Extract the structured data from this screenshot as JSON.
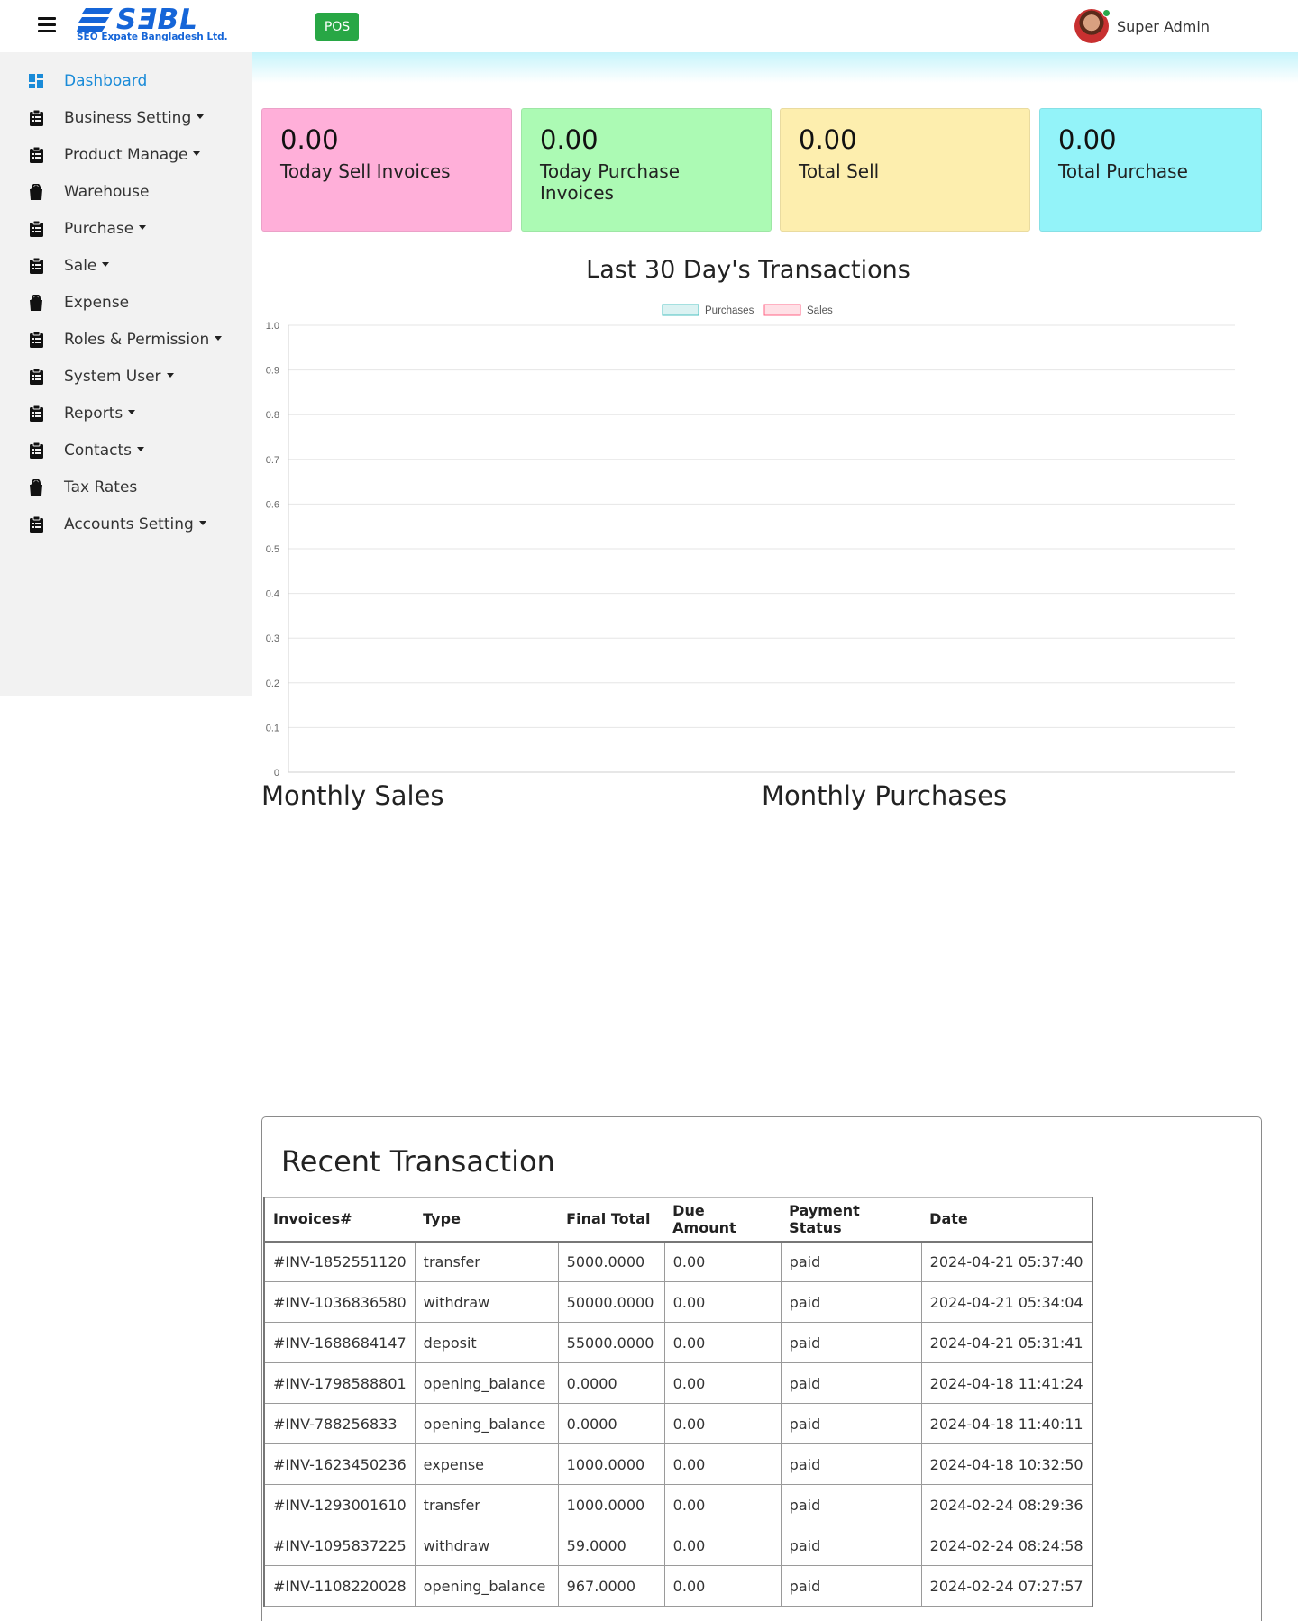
{
  "header": {
    "logo_text": "SƎBL",
    "logo_subtitle": "SEO Expate Bangladesh Ltd.",
    "pos_label": "POS",
    "user_name": "Super Admin"
  },
  "sidebar": {
    "items": [
      {
        "label": "Dashboard",
        "icon": "dashboard-icon",
        "dropdown": false,
        "active": true
      },
      {
        "label": "Business Setting",
        "icon": "clipboard-icon",
        "dropdown": true
      },
      {
        "label": "Product Manage",
        "icon": "clipboard-icon",
        "dropdown": true
      },
      {
        "label": "Warehouse",
        "icon": "bag-icon",
        "dropdown": false
      },
      {
        "label": "Purchase",
        "icon": "clipboard-icon",
        "dropdown": true
      },
      {
        "label": "Sale",
        "icon": "clipboard-icon",
        "dropdown": true
      },
      {
        "label": "Expense",
        "icon": "bag-icon",
        "dropdown": false
      },
      {
        "label": "Roles & Permission",
        "icon": "clipboard-icon",
        "dropdown": true
      },
      {
        "label": "System User",
        "icon": "clipboard-icon",
        "dropdown": true
      },
      {
        "label": "Reports",
        "icon": "clipboard-icon",
        "dropdown": true
      },
      {
        "label": "Contacts",
        "icon": "clipboard-icon",
        "dropdown": true
      },
      {
        "label": "Tax Rates",
        "icon": "bag-icon",
        "dropdown": false
      },
      {
        "label": "Accounts Setting",
        "icon": "clipboard-icon",
        "dropdown": true
      }
    ]
  },
  "cards": [
    {
      "value": "0.00",
      "label": "Today Sell Invoices",
      "color": "#ffafd9"
    },
    {
      "value": "0.00",
      "label": "Today Purchase Invoices",
      "color": "#acfab4"
    },
    {
      "value": "0.00",
      "label": "Total Sell",
      "color": "#fdeeae"
    },
    {
      "value": "0.00",
      "label": "Total Purchase",
      "color": "#93f3f9"
    }
  ],
  "chart_data": {
    "type": "line",
    "title": "Last 30 Day's Transactions",
    "series": [
      {
        "name": "Purchases",
        "values": [],
        "color": "#4bc0c0"
      },
      {
        "name": "Sales",
        "values": [],
        "color": "#ff6384"
      }
    ],
    "y_ticks": [
      "0",
      "0.1",
      "0.2",
      "0.3",
      "0.4",
      "0.5",
      "0.6",
      "0.7",
      "0.8",
      "0.9",
      "1.0"
    ],
    "ylim": [
      0,
      1
    ],
    "grid": true,
    "legend": "top-center"
  },
  "sections": {
    "monthly_sales": "Monthly Sales",
    "monthly_purchases": "Monthly Purchases"
  },
  "recent": {
    "title": "Recent Transaction",
    "columns": [
      "Invoices#",
      "Type",
      "Final Total",
      "Due Amount",
      "Payment Status",
      "Date"
    ],
    "rows": [
      [
        "#INV-1852551120",
        "transfer",
        "5000.0000",
        "0.00",
        "paid",
        "2024-04-21 05:37:40"
      ],
      [
        "#INV-1036836580",
        "withdraw",
        "50000.0000",
        "0.00",
        "paid",
        "2024-04-21 05:34:04"
      ],
      [
        "#INV-1688684147",
        "deposit",
        "55000.0000",
        "0.00",
        "paid",
        "2024-04-21 05:31:41"
      ],
      [
        "#INV-1798588801",
        "opening_balance",
        "0.0000",
        "0.00",
        "paid",
        "2024-04-18 11:41:24"
      ],
      [
        "#INV-788256833",
        "opening_balance",
        "0.0000",
        "0.00",
        "paid",
        "2024-04-18 11:40:11"
      ],
      [
        "#INV-1623450236",
        "expense",
        "1000.0000",
        "0.00",
        "paid",
        "2024-04-18 10:32:50"
      ],
      [
        "#INV-1293001610",
        "transfer",
        "1000.0000",
        "0.00",
        "paid",
        "2024-02-24 08:29:36"
      ],
      [
        "#INV-1095837225",
        "withdraw",
        "59.0000",
        "0.00",
        "paid",
        "2024-02-24 08:24:58"
      ],
      [
        "#INV-1108220028",
        "opening_balance",
        "967.0000",
        "0.00",
        "paid",
        "2024-02-24 07:27:57"
      ]
    ]
  }
}
